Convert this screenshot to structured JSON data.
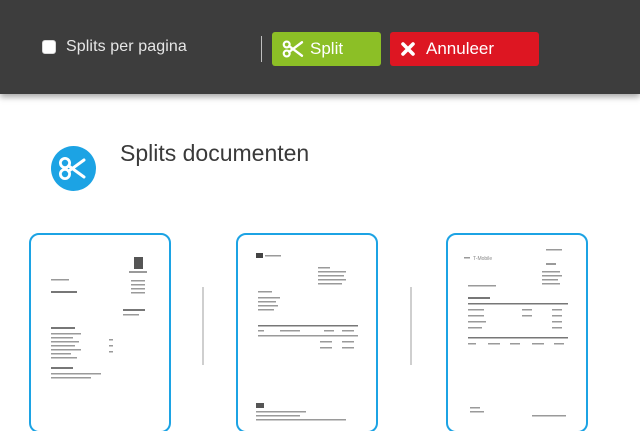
{
  "toolbar": {
    "split_per_page_label": "Splits per pagina",
    "split_per_page_checked": false,
    "split_button_label": "Split",
    "cancel_button_label": "Annuleer",
    "colors": {
      "bar": "#3d3d3d",
      "split": "#8cbf26",
      "cancel": "#dd1622"
    }
  },
  "heading": {
    "title": "Splits documenten",
    "icon": "scissors-icon",
    "accent": "#1ca3e4"
  },
  "pages": {
    "thumbnails": [
      {
        "name": "page-thumbnail-1",
        "logo": ""
      },
      {
        "name": "page-thumbnail-2",
        "logo": ""
      },
      {
        "name": "page-thumbnail-3",
        "logo": "T-Mobile"
      }
    ]
  }
}
